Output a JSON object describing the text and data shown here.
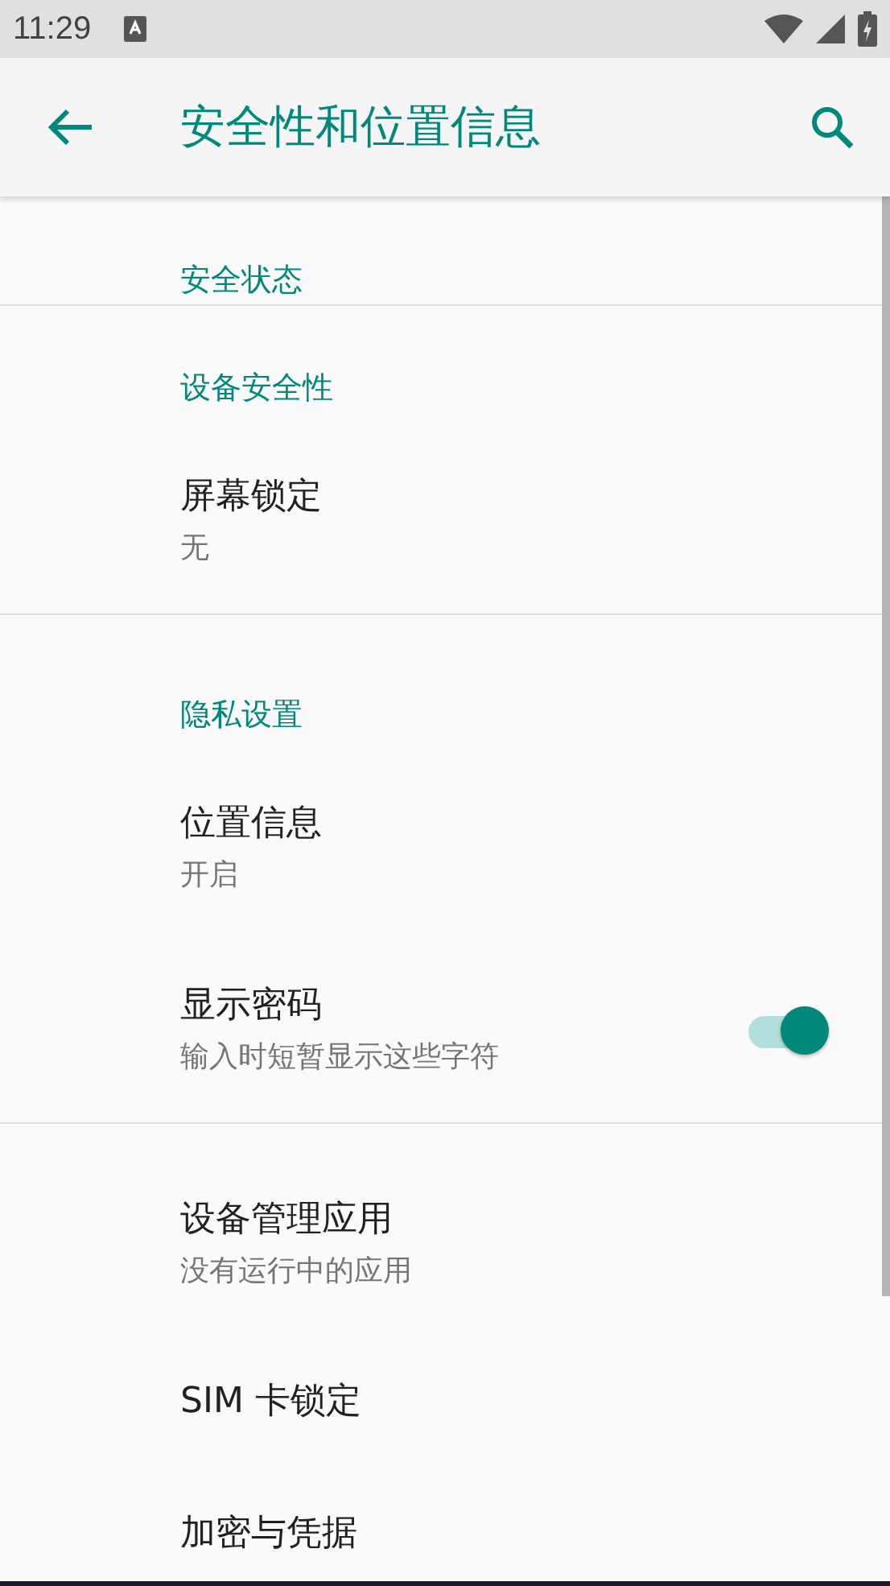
{
  "status_bar": {
    "time": "11:29"
  },
  "toolbar": {
    "title": "安全性和位置信息"
  },
  "groups": [
    {
      "header": "安全状态"
    },
    {
      "header": "设备安全性",
      "items": [
        {
          "kind": "text",
          "title": "屏幕锁定",
          "summary": "无"
        }
      ]
    },
    {
      "header": "隐私设置",
      "items": [
        {
          "kind": "text",
          "title": "位置信息",
          "summary": "开启"
        },
        {
          "kind": "switch",
          "title": "显示密码",
          "summary": "输入时短暂显示这些字符",
          "on": true
        }
      ]
    },
    {
      "items": [
        {
          "kind": "text",
          "title": "设备管理应用",
          "summary": "没有运行中的应用"
        },
        {
          "kind": "text",
          "title": "SIM 卡锁定"
        },
        {
          "kind": "text",
          "title": "加密与凭据"
        }
      ]
    }
  ]
}
